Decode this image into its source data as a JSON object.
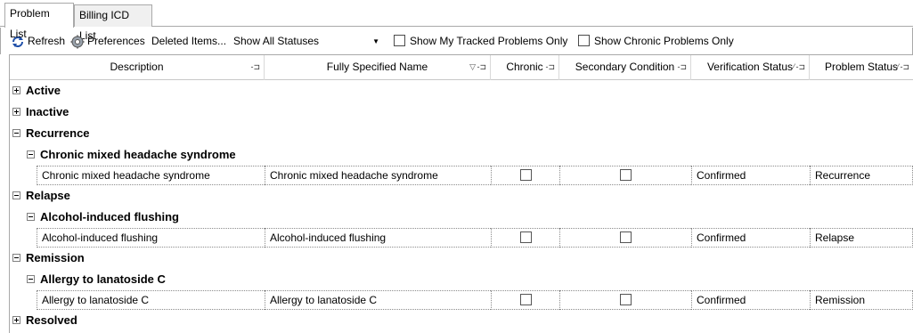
{
  "tabs": [
    {
      "label": "Problem List",
      "active": true
    },
    {
      "label": "Billing ICD List",
      "active": false
    }
  ],
  "toolbar": {
    "refresh_label": "Refresh",
    "preferences_label": "Preferences",
    "deleted_items_label": "Deleted Items...",
    "status_filter_value": "Show All Statuses",
    "tracked_label": "Show My Tracked Problems Only",
    "chronic_label": "Show Chronic Problems Only"
  },
  "columns": [
    {
      "label": "Description"
    },
    {
      "label": "Fully Specified Name"
    },
    {
      "label": "Chronic"
    },
    {
      "label": "Secondary Condition"
    },
    {
      "label": "Verification Status"
    },
    {
      "label": "Problem Status"
    }
  ],
  "groups": {
    "active": "Active",
    "inactive": "Inactive",
    "recurrence": "Recurrence",
    "recurrence_sub": "Chronic mixed headache syndrome",
    "relapse": "Relapse",
    "relapse_sub": "Alcohol-induced flushing",
    "remission": "Remission",
    "remission_sub": "Allergy to lanatoside C",
    "resolved": "Resolved"
  },
  "rows": [
    {
      "description": "Chronic mixed headache syndrome",
      "fsn": "Chronic mixed headache syndrome",
      "verification": "Confirmed",
      "status": "Recurrence"
    },
    {
      "description": "Alcohol-induced flushing",
      "fsn": "Alcohol-induced flushing",
      "verification": "Confirmed",
      "status": "Relapse"
    },
    {
      "description": "Allergy to lanatoside C",
      "fsn": "Allergy to lanatoside C",
      "verification": "Confirmed",
      "status": "Remission"
    }
  ]
}
